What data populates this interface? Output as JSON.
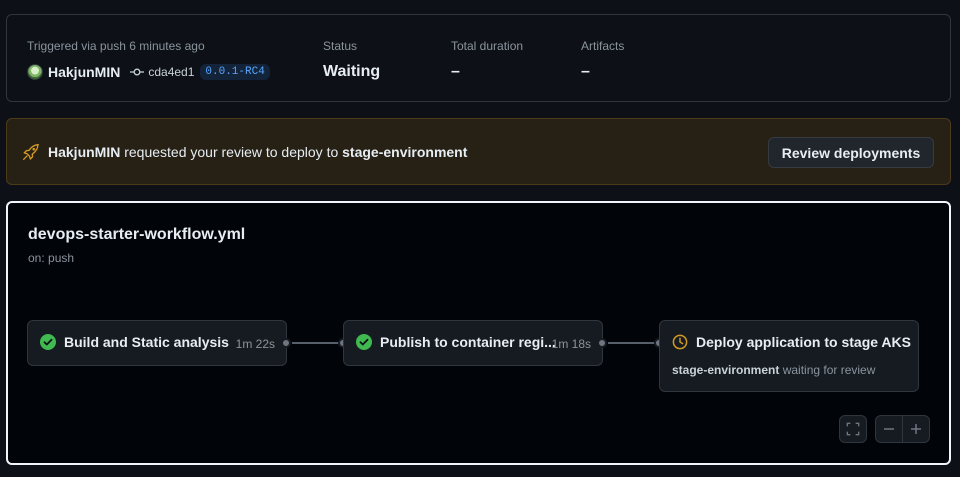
{
  "summary": {
    "trigger_label": "Triggered via push 6 minutes ago",
    "user": "HakjunMIN",
    "commit_sha": "cda4ed1",
    "tag": "0.0.1-RC4",
    "status_label": "Status",
    "status_value": "Waiting",
    "duration_label": "Total duration",
    "duration_value": "–",
    "artifacts_label": "Artifacts",
    "artifacts_value": "–"
  },
  "banner": {
    "user": "HakjunMIN",
    "message": " requested your review to deploy to ",
    "environment": "stage-environment",
    "button_label": "Review deployments",
    "icon": "rocket-icon",
    "accent_color": "#d29922"
  },
  "workflow": {
    "file": "devops-starter-workflow.yml",
    "trigger": "on: push",
    "jobs": [
      {
        "name": "Build and Static analysis",
        "duration": "1m 22s",
        "status": "success"
      },
      {
        "name": "Publish to container regi...",
        "duration": "1m 18s",
        "status": "success"
      },
      {
        "name": "Deploy application to stage AKS",
        "status": "waiting",
        "env": "stage-environment",
        "env_note": " waiting for review"
      }
    ],
    "colors": {
      "success": "#3fb950",
      "waiting": "#d29922"
    }
  }
}
